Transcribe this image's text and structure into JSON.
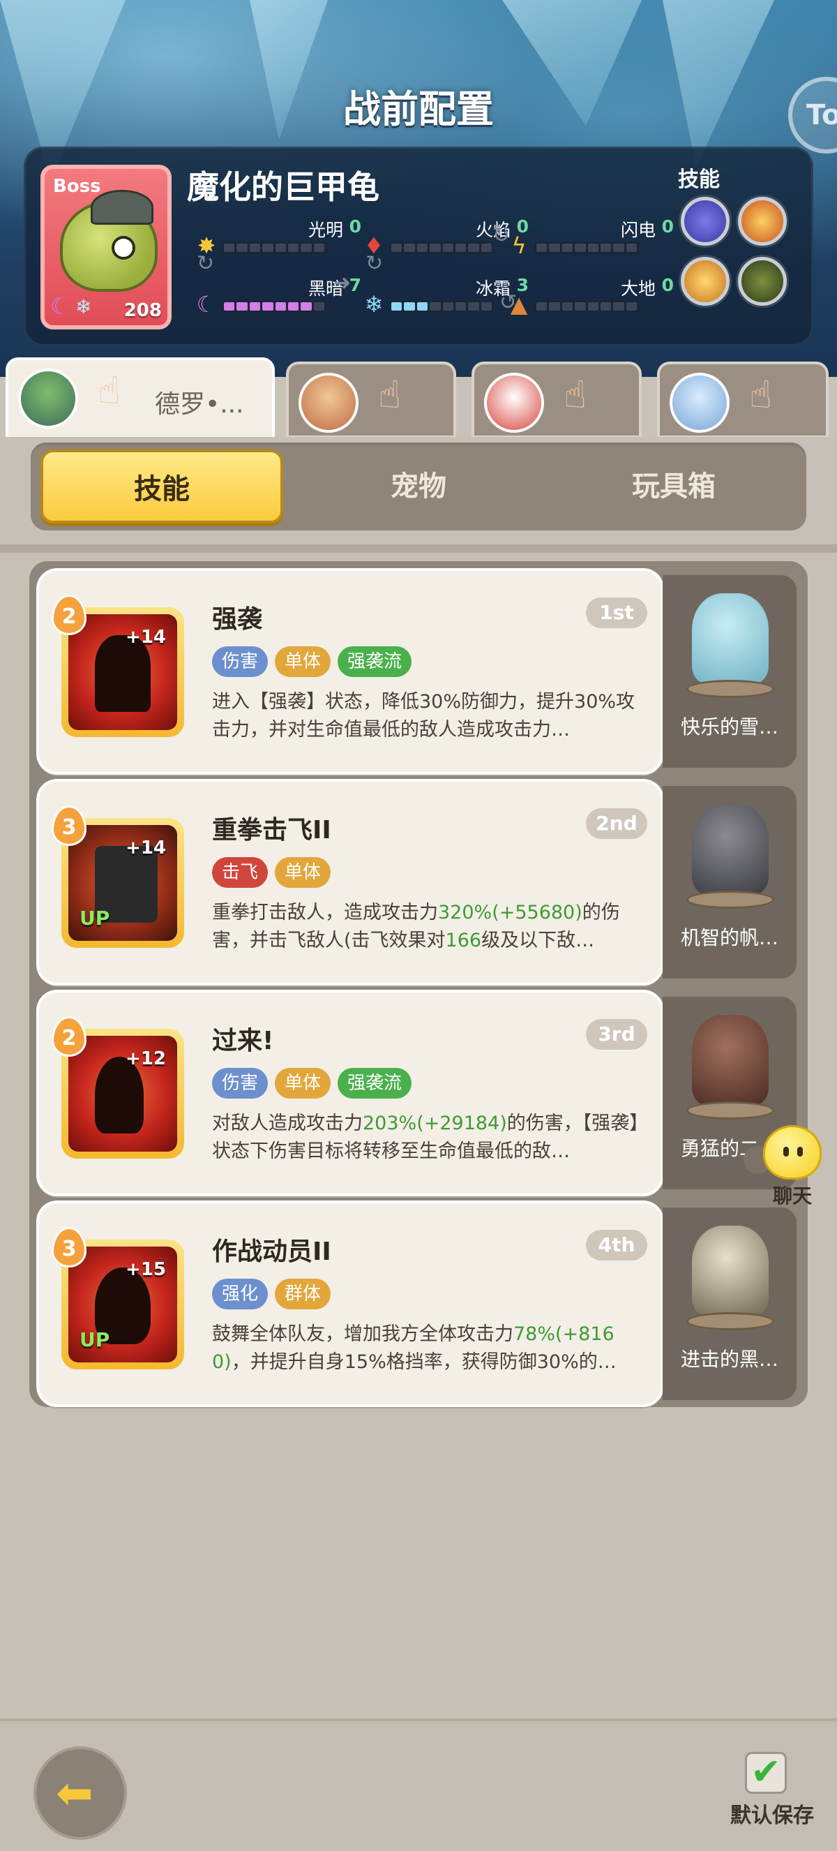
{
  "page_title": "战前配置",
  "edge_button_text": "To",
  "boss": {
    "tag": "Boss",
    "name": "魔化的巨甲龟",
    "level": "208",
    "skills_title": "技能",
    "elements": [
      {
        "label": "光明",
        "value": "0",
        "icon": "sun-icon",
        "glyph": "✸",
        "color": "#f6c63a",
        "level": 0
      },
      {
        "label": "火焰",
        "value": "0",
        "icon": "fire-icon",
        "glyph": "♦",
        "color": "#e2483b",
        "level": 0
      },
      {
        "label": "闪电",
        "value": "0",
        "icon": "lightning-icon",
        "glyph": "ϟ",
        "color": "#f6c63a",
        "level": 0
      },
      {
        "label": "黑暗",
        "value": "7",
        "icon": "moon-icon",
        "glyph": "☾",
        "color": "#d47ee8",
        "level": 7
      },
      {
        "label": "冰霜",
        "value": "3",
        "icon": "snowflake-icon",
        "glyph": "❄",
        "color": "#8ed7f5",
        "level": 3
      },
      {
        "label": "大地",
        "value": "0",
        "icon": "mountain-icon",
        "glyph": "▲",
        "color": "#e0863b",
        "level": 0
      }
    ]
  },
  "hero_tabs": [
    {
      "name": "德罗•...",
      "active": true
    },
    {
      "name": "",
      "active": false
    },
    {
      "name": "",
      "active": false
    },
    {
      "name": "",
      "active": false
    }
  ],
  "sub_tabs": [
    "技能",
    "宠物",
    "玩具箱"
  ],
  "skills": [
    {
      "name": "强袭",
      "rank": "1st",
      "level": "2",
      "plus": "+14",
      "up": "",
      "tags": [
        {
          "text": "伤害",
          "color": "blue"
        },
        {
          "text": "单体",
          "color": "yellow"
        },
        {
          "text": "强袭流",
          "color": "green"
        }
      ],
      "desc_parts": [
        {
          "text": "进入【强袭】状态，降低30%防御力，提升30%攻击力，并对生命值最低的敌人造成攻击力…",
          "hl": false
        }
      ],
      "pet_name": "快乐的雪…"
    },
    {
      "name": "重拳击飞II",
      "rank": "2nd",
      "level": "3",
      "plus": "+14",
      "up": "UP",
      "tags": [
        {
          "text": "击飞",
          "color": "red"
        },
        {
          "text": "单体",
          "color": "yellow"
        }
      ],
      "desc_parts": [
        {
          "text": "重拳打击敌人，造成攻击力",
          "hl": false
        },
        {
          "text": "320%(+55680)",
          "hl": true
        },
        {
          "text": "的伤害，并击飞敌人(击飞效果对",
          "hl": false
        },
        {
          "text": "166",
          "hl": true
        },
        {
          "text": "级及以下敌…",
          "hl": false
        }
      ],
      "pet_name": "机智的帆…"
    },
    {
      "name": "过来!",
      "rank": "3rd",
      "level": "2",
      "plus": "+12",
      "up": "",
      "tags": [
        {
          "text": "伤害",
          "color": "blue"
        },
        {
          "text": "单体",
          "color": "yellow"
        },
        {
          "text": "强袭流",
          "color": "green"
        }
      ],
      "desc_parts": [
        {
          "text": "对敌人造成攻击力",
          "hl": false
        },
        {
          "text": "203%(+29184)",
          "hl": true
        },
        {
          "text": "的伤害，【强袭】状态下伤害目标将转移至生命值最低的敌…",
          "hl": false
        }
      ],
      "pet_name": "勇猛的二…"
    },
    {
      "name": "作战动员II",
      "rank": "4th",
      "level": "3",
      "plus": "+15",
      "up": "UP",
      "tags": [
        {
          "text": "强化",
          "color": "blue"
        },
        {
          "text": "群体",
          "color": "yellow"
        }
      ],
      "desc_parts": [
        {
          "text": "鼓舞全体队友，增加我方全体攻击力",
          "hl": false
        },
        {
          "text": "78%(+8160)",
          "hl": true
        },
        {
          "text": "，并提升自身15%格挡率，获得防御30%的…",
          "hl": false
        }
      ],
      "pet_name": "进击的黑…"
    }
  ],
  "chat_label": "聊天",
  "save_label": "默认保存"
}
